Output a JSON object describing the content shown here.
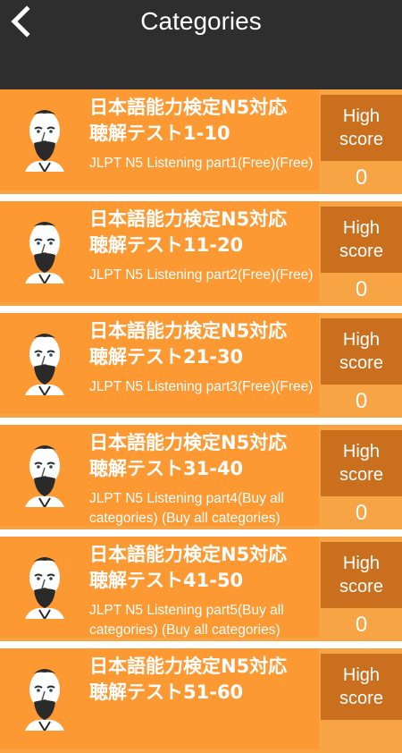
{
  "header": {
    "title": "Categories",
    "back_icon": "chevron-left-icon"
  },
  "colors": {
    "header_bg": "#2e2e2e",
    "card_bg": "#fd9932",
    "card_outer": "#f7a544",
    "high_score_bg": "#c96f1e",
    "text": "#ffffff"
  },
  "categories": [
    {
      "title_line1": "日本語能力検定N5対応",
      "title_line2": "聴解テスト1-10",
      "subtitle": "JLPT N5 Listening part1(Free)(Free)",
      "high_score_label_1": "High",
      "high_score_label_2": "score",
      "high_score_value": "0",
      "icon": "portrait-icon"
    },
    {
      "title_line1": "日本語能力検定N5対応",
      "title_line2": "聴解テスト11-20",
      "subtitle": "JLPT N5 Listening part2(Free)(Free)",
      "high_score_label_1": "High",
      "high_score_label_2": "score",
      "high_score_value": "0",
      "icon": "portrait-icon"
    },
    {
      "title_line1": "日本語能力検定N5対応",
      "title_line2": "聴解テスト21-30",
      "subtitle": "JLPT N5 Listening part3(Free)(Free)",
      "high_score_label_1": "High",
      "high_score_label_2": "score",
      "high_score_value": "0",
      "icon": "portrait-icon"
    },
    {
      "title_line1": "日本語能力検定N5対応",
      "title_line2": "聴解テスト31-40",
      "subtitle": "JLPT N5 Listening part4(Buy all categories) (Buy all categories)",
      "high_score_label_1": "High",
      "high_score_label_2": "score",
      "high_score_value": "0",
      "icon": "portrait-icon"
    },
    {
      "title_line1": "日本語能力検定N5対応",
      "title_line2": "聴解テスト41-50",
      "subtitle": "JLPT N5 Listening part5(Buy all categories) (Buy all categories)",
      "high_score_label_1": "High",
      "high_score_label_2": "score",
      "high_score_value": "0",
      "icon": "portrait-icon"
    },
    {
      "title_line1": "日本語能力検定N5対応",
      "title_line2": "聴解テスト51-60",
      "subtitle": "",
      "high_score_label_1": "High",
      "high_score_label_2": "score",
      "high_score_value": "",
      "icon": "portrait-icon"
    }
  ]
}
